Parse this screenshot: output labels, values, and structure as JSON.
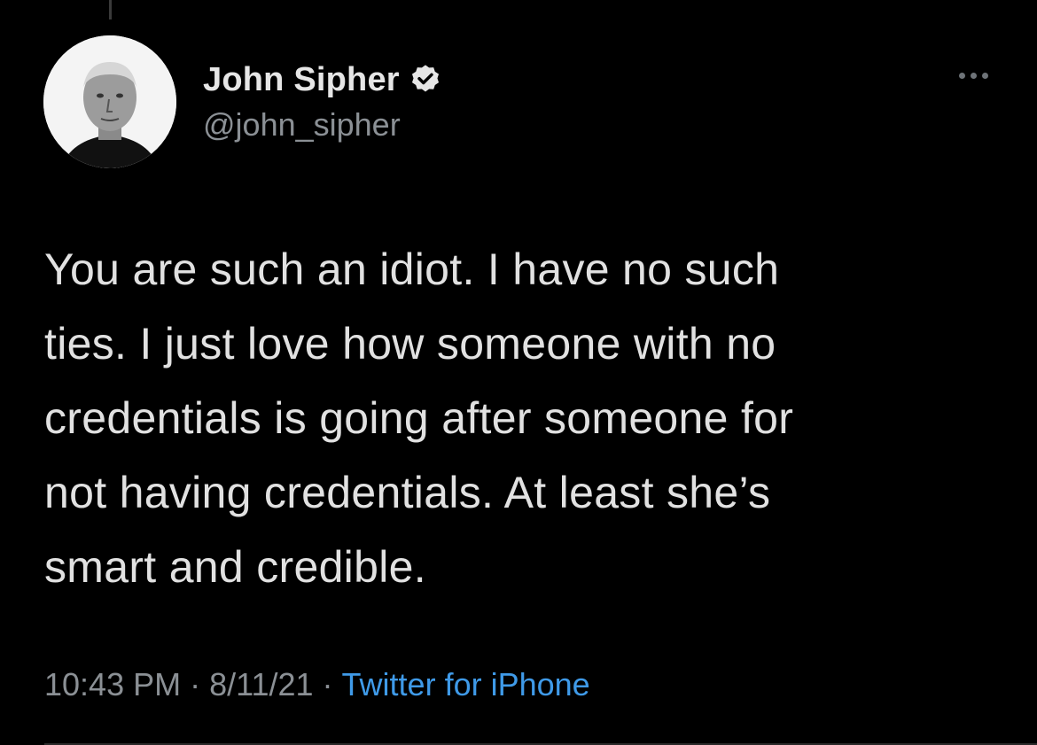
{
  "tweet": {
    "author": {
      "display_name": "John Sipher",
      "handle": "@john_sipher",
      "verified": true,
      "avatar_icon": "profile-photo"
    },
    "text": "You are such an idiot. I have no such\nties. I just love how someone with no\ncredentials is going after someone for\nnot having credentials. At least she’s\nsmart and credible.",
    "time": "10:43 PM",
    "separator": "·",
    "date": "8/11/21",
    "source": "Twitter for iPhone"
  },
  "icons": {
    "verified": "verified-badge-icon",
    "more": "more-options-icon"
  },
  "colors": {
    "background": "#000000",
    "text": "#e1e1e1",
    "secondary": "#8b9095",
    "link": "#3f9ae8"
  }
}
